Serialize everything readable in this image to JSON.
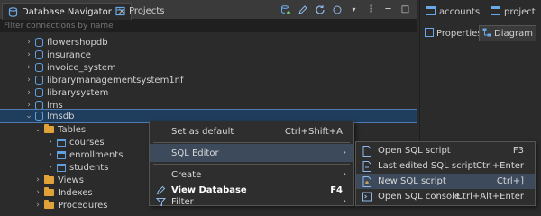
{
  "left_tabs": [
    {
      "label": "Database Navigator",
      "icon": "database-navigator-icon",
      "active": true
    },
    {
      "label": "Projects",
      "icon": "projects-icon",
      "active": false
    }
  ],
  "filter": {
    "placeholder": "Filter connections by name"
  },
  "tree": [
    {
      "label": "flowershopdb",
      "type": "db"
    },
    {
      "label": "insurance",
      "type": "db"
    },
    {
      "label": "invoice_system",
      "type": "db"
    },
    {
      "label": "librarymanagementsystem1nf",
      "type": "db"
    },
    {
      "label": "librarysystem",
      "type": "db"
    },
    {
      "label": "lms",
      "type": "db"
    },
    {
      "label": "lmsdb",
      "type": "db",
      "selected": true
    },
    {
      "label": "Tables",
      "type": "folder"
    },
    {
      "label": "courses",
      "type": "table"
    },
    {
      "label": "enrollments",
      "type": "table"
    },
    {
      "label": "students",
      "type": "table"
    },
    {
      "label": "Views",
      "type": "folder"
    },
    {
      "label": "Indexes",
      "type": "folder"
    },
    {
      "label": "Procedures",
      "type": "folder"
    }
  ],
  "context_menu": {
    "items": [
      {
        "label": "Set as default",
        "shortcut": "Ctrl+Shift+A"
      },
      {
        "label": "SQL Editor",
        "submenu": true
      },
      {
        "label": "Create",
        "submenu": true
      },
      {
        "label": "View Database",
        "shortcut": "F4"
      },
      {
        "label": "Filter",
        "submenu": true
      }
    ]
  },
  "sql_submenu": {
    "items": [
      {
        "label": "Open SQL script",
        "shortcut": "F3"
      },
      {
        "label": "Last edited SQL script",
        "shortcut": "Ctrl+Enter"
      },
      {
        "label": "New SQL script",
        "shortcut": "Ctrl+]"
      },
      {
        "label": "Open SQL console",
        "shortcut": "Ctrl+Alt+Enter"
      }
    ]
  },
  "right_tabs": [
    {
      "label": "accounts"
    },
    {
      "label": "project"
    }
  ],
  "right_subtabs": [
    {
      "label": "Properties"
    },
    {
      "label": "Diagram"
    }
  ],
  "colors": {
    "accent": "#4e7cb0",
    "selection": "#1f3d5c",
    "folder": "#e2a23a",
    "db": "#5fa0e0"
  }
}
